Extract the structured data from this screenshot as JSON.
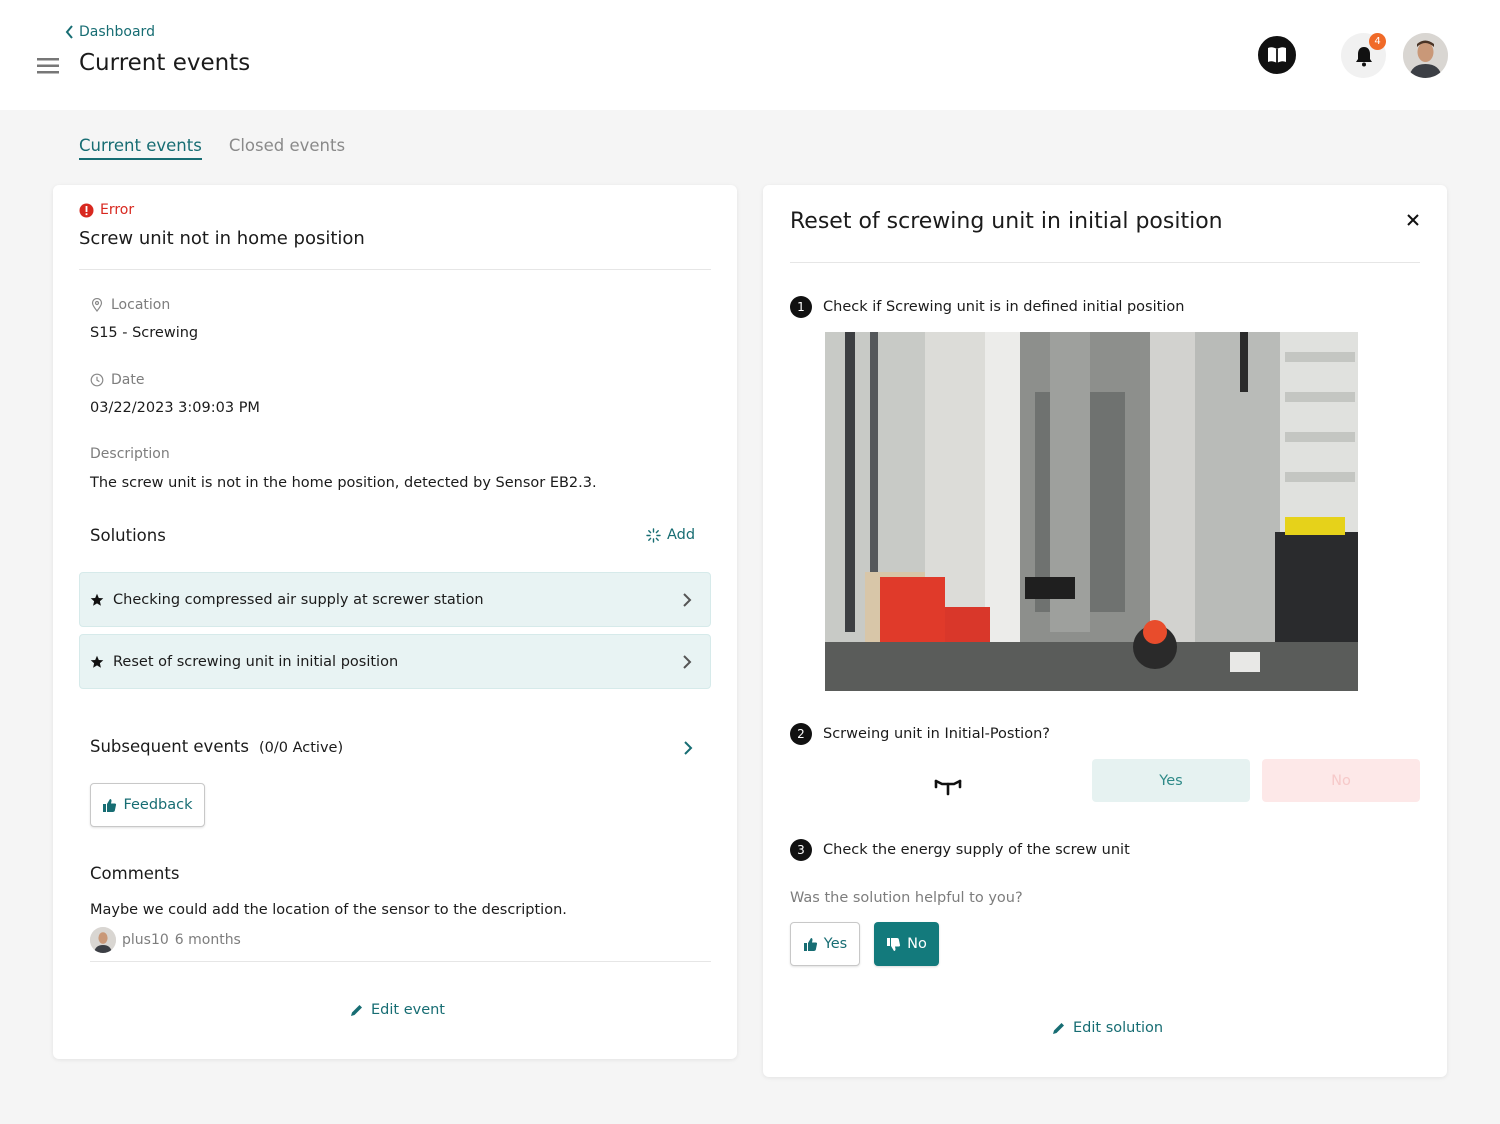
{
  "header": {
    "back_label": "Dashboard",
    "title": "Current events",
    "notification_count": "4"
  },
  "tabs": [
    {
      "label": "Current events",
      "active": true
    },
    {
      "label": "Closed events",
      "active": false
    }
  ],
  "event": {
    "severity": "Error",
    "title": "Screw unit not in home position",
    "location_label": "Location",
    "location_value": "S15 - Screwing",
    "date_label": "Date",
    "date_value": "03/22/2023 3:09:03 PM",
    "description_label": "Description",
    "description_value": "The screw unit is not in the home position, detected by Sensor EB2.3.",
    "solutions_heading": "Solutions",
    "add_label": "Add",
    "solutions": [
      {
        "label": "Checking compressed air supply at screwer station"
      },
      {
        "label": "Reset of screwing unit in initial position"
      }
    ],
    "subsequent_heading": "Subsequent events",
    "subsequent_count": "(0/0 Active)",
    "feedback_label": "Feedback",
    "comments_heading": "Comments",
    "comment_text": "Maybe we could add the location of the sensor to the description.",
    "comment_author": "plus10",
    "comment_age": "6 months",
    "edit_label": "Edit event"
  },
  "solution": {
    "title": "Reset of screwing unit in initial position",
    "steps": [
      {
        "number": "1",
        "text": "Check if Screwing unit is in defined initial position"
      },
      {
        "number": "2",
        "text": "Scrweing unit in Initial-Postion?"
      },
      {
        "number": "3",
        "text": "Check the energy supply of the screw unit"
      }
    ],
    "step2_yes": "Yes",
    "step2_no": "No",
    "helpful_question": "Was the solution helpful to you?",
    "helpful_yes": "Yes",
    "helpful_no": "No",
    "edit_label": "Edit solution"
  },
  "colors": {
    "accent": "#176d73",
    "error": "#d8281f",
    "badge": "#f06a28"
  }
}
